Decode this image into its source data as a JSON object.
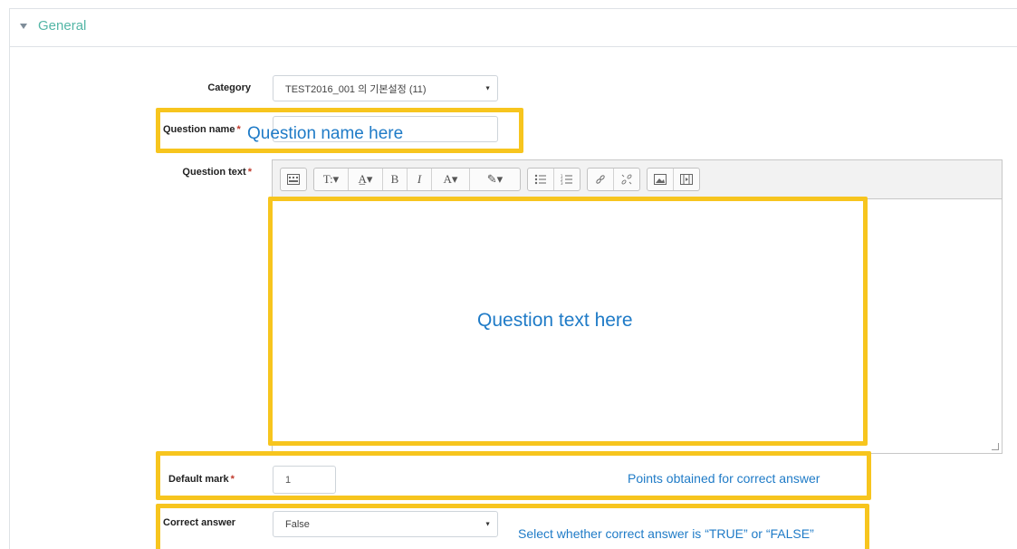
{
  "section": {
    "title": "General"
  },
  "form": {
    "category": {
      "label": "Category",
      "value": "TEST2016_001 의 기본설정 (11)"
    },
    "question_name": {
      "label": "Question name",
      "required": "*",
      "value": ""
    },
    "question_text": {
      "label": "Question text",
      "required": "*"
    },
    "default_mark": {
      "label": "Default mark",
      "required": "*",
      "value": "1"
    },
    "correct_answer": {
      "label": "Correct answer",
      "value": "False"
    }
  },
  "editor_toolbar": {
    "groups": [
      [
        "show-more-buttons-icon"
      ],
      [
        "text-style-icon",
        "font-size-icon",
        "bold-icon",
        "italic-icon",
        "font-color-icon",
        "background-color-icon"
      ],
      [
        "unordered-list-icon",
        "ordered-list-icon"
      ],
      [
        "link-icon",
        "unlink-icon"
      ],
      [
        "image-icon",
        "media-icon"
      ]
    ],
    "glyphs": {
      "text_style": "T:▾",
      "font_size": "A̲▾",
      "bold": "B",
      "italic": "I",
      "font_color": "A▾",
      "bg_color": "✎▾"
    }
  },
  "annotations": {
    "question_name": "Question name here",
    "question_text": "Question text here",
    "default_mark": "Points obtained for correct answer",
    "correct_answer": "Select whether correct answer is “TRUE” or “FALSE”"
  },
  "colors": {
    "highlight": "#f7c51e",
    "annotation_text": "#1f7bc7",
    "section_title": "#53b6a6",
    "required_marker": "#c0392b"
  }
}
